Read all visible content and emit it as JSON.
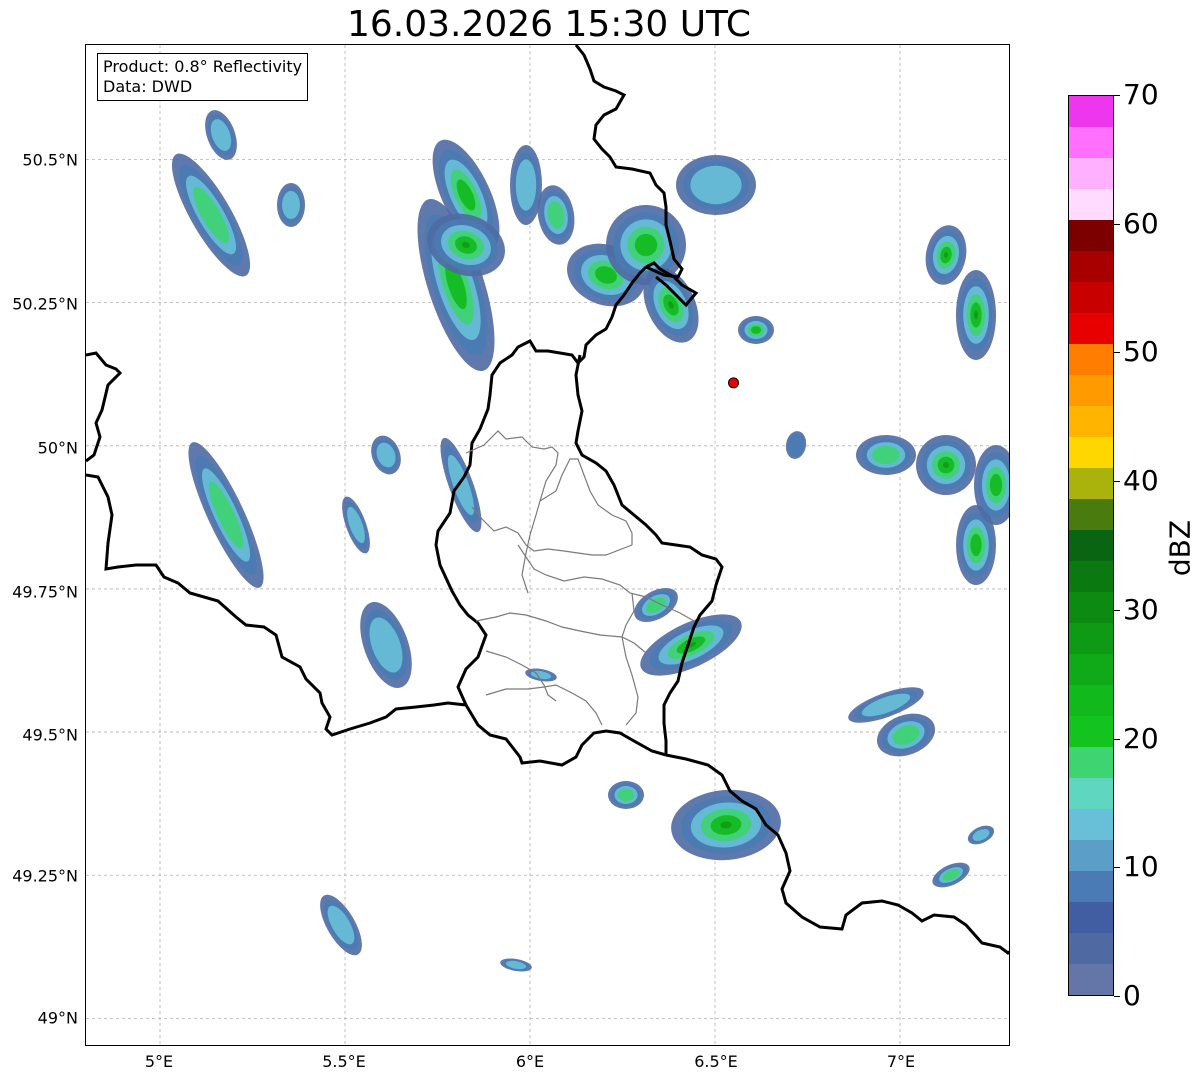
{
  "title": "16.03.2026 15:30 UTC",
  "info_box": {
    "product": "Product: 0.8° Reflectivity",
    "data_source": "Data: DWD"
  },
  "map": {
    "lon_range": [
      4.8,
      7.3
    ],
    "lat_range": [
      48.95,
      50.7
    ],
    "lat_labels": [
      "50.5°N",
      "50.25°N",
      "50°N",
      "49.75°N",
      "49.5°N",
      "49.25°N",
      "49°N"
    ],
    "lon_labels": [
      "5°E",
      "5.5°E",
      "6°E",
      "6.5°E",
      "7°E"
    ],
    "gridlines": "dashed",
    "radar_site_marker": {
      "lon": 6.55,
      "lat": 50.11,
      "color": "#e60000"
    }
  },
  "colorbar": {
    "label": "dBZ",
    "min": 0,
    "max": 70,
    "tick_labels": [
      "0",
      "10",
      "20",
      "30",
      "40",
      "50",
      "60",
      "70"
    ],
    "colors": [
      "#6475a8",
      "#4f6aa3",
      "#425ea3",
      "#4a7bb4",
      "#5b9ec8",
      "#68c0d8",
      "#5fd6c0",
      "#3ed471",
      "#13c41f",
      "#12b91c",
      "#10aa18",
      "#0e9a15",
      "#0c8a12",
      "#0a7a10",
      "#0a6512",
      "#4a7b0e",
      "#aab30c",
      "#ffd700",
      "#ffb400",
      "#ff9a00",
      "#ff7d00",
      "#e80000",
      "#c80000",
      "#a80000",
      "#7d0000",
      "#ffdcff",
      "#ffb0ff",
      "#ff70ff",
      "#ee36ee"
    ]
  }
}
